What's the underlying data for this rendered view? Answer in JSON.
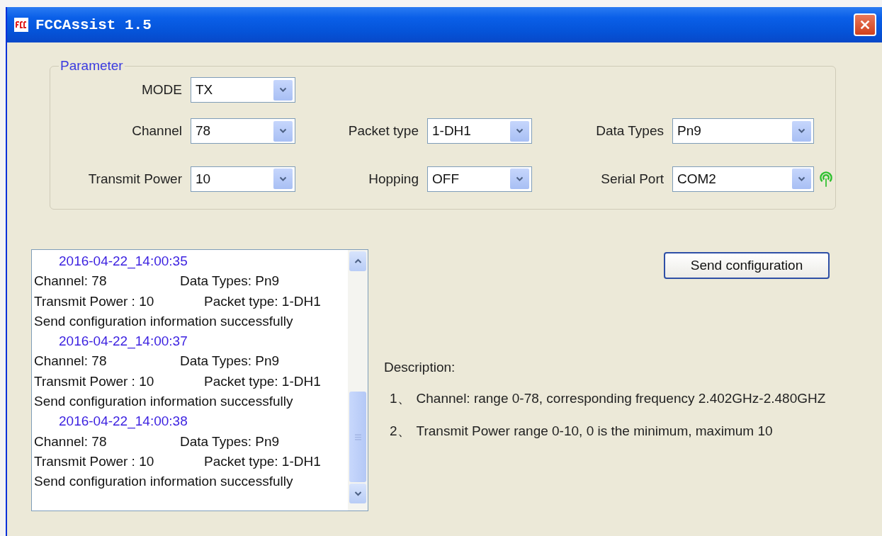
{
  "window": {
    "title": "FCCAssist 1.5"
  },
  "parameter": {
    "title": "Parameter",
    "fields": [
      {
        "label": "MODE",
        "value": "TX",
        "kind": "combo"
      },
      {
        "label": "Channel",
        "value": "78",
        "kind": "combo"
      },
      {
        "label": "Packet type",
        "value": "1-DH1",
        "kind": "combo"
      },
      {
        "label": "Data Types",
        "value": "Pn9",
        "kind": "combo"
      },
      {
        "label": "Transmit Power",
        "value": "10",
        "kind": "combo"
      },
      {
        "label": "Hopping",
        "value": "OFF",
        "kind": "combo"
      },
      {
        "label": "Serial Port",
        "value": "COM2",
        "kind": "port"
      }
    ]
  },
  "log": [
    {
      "timestamp": "2016-04-22_14:00:35",
      "channel": "Channel: 78",
      "data_types": "Data Types: Pn9",
      "transmit_power": "Transmit Power : 10",
      "packet_type": "Packet type: 1-DH1",
      "message": "Send configuration information successfully"
    },
    {
      "timestamp": "2016-04-22_14:00:37",
      "channel": "Channel: 78",
      "data_types": "Data Types: Pn9",
      "transmit_power": "Transmit Power : 10",
      "packet_type": "Packet type: 1-DH1",
      "message": "Send configuration information successfully"
    },
    {
      "timestamp": "2016-04-22_14:00:38",
      "channel": "Channel: 78",
      "data_types": "Data Types: Pn9",
      "transmit_power": "Transmit Power : 10",
      "packet_type": "Packet type: 1-DH1",
      "message": "Send configuration information successfully"
    }
  ],
  "send_button": "Send configuration",
  "description": {
    "title": "Description:",
    "items": [
      {
        "number": "1、",
        "text": "Channel: range 0-78, corresponding frequency 2.402GHz-2.480GHZ"
      },
      {
        "number": "2、",
        "text": "Transmit Power  range 0-10, 0 is the minimum, maximum 10"
      }
    ]
  }
}
